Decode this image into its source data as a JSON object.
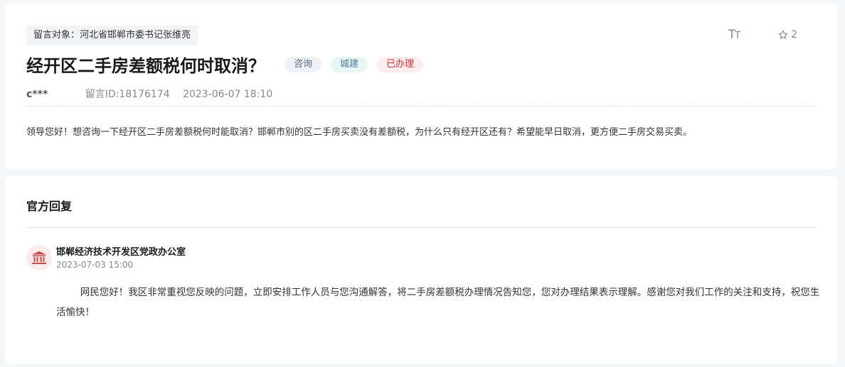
{
  "message": {
    "target_label": "留言对象：河北省邯郸市委书记张维亮",
    "title": "经开区二手房差额税何时取消？",
    "tags": [
      "咨询",
      "城建",
      "已办理"
    ],
    "author": "c***",
    "message_id": "留言ID:18176174",
    "timestamp": "2023-06-07 18:10",
    "body": "领导您好！想咨询一下经开区二手房差额税何时能取消？邯郸市别的区二手房买卖没有差额税，为什么只有经开区还有？希望能早日取消，更方便二手房交易买卖。",
    "toolbar": {
      "font_size_icon": "text-size-icon",
      "favorite_icon": "star-icon",
      "favorite_count": "2"
    }
  },
  "reply": {
    "heading": "官方回复",
    "org_icon": "government-building-icon",
    "org_name": "邯郸经济技术开发区党政办公室",
    "timestamp": "2023-07-03 15:00",
    "text": "网民您好！我区非常重视您反映的问题，立即安排工作人员与您沟通解答，将二手房差额税办理情况告知您，您对办理结果表示理解。感谢您对我们工作的关注和支持，祝您生活愉快！"
  },
  "colors": {
    "page_bg": "#f5f6f8",
    "card_bg": "#ffffff",
    "status_done": "#d0323c",
    "icon_red": "#c94a4a"
  }
}
